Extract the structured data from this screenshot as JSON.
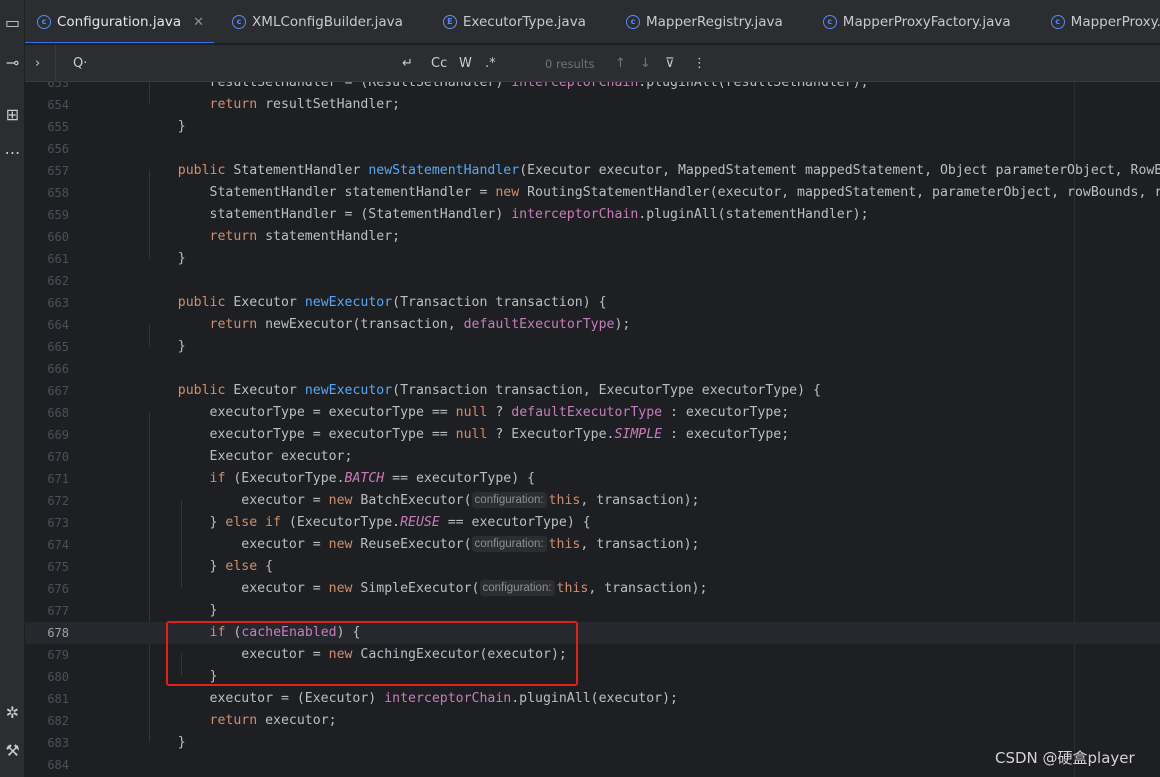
{
  "tabs": [
    {
      "label": "Configuration.java",
      "icon": "class-icon",
      "icon_glyph": "c",
      "active": true,
      "closable": true
    },
    {
      "label": "XMLConfigBuilder.java",
      "icon": "class-icon",
      "icon_glyph": "c"
    },
    {
      "label": "ExecutorType.java",
      "icon": "enum-icon",
      "icon_glyph": "E"
    },
    {
      "label": "MapperRegistry.java",
      "icon": "class-icon",
      "icon_glyph": "c"
    },
    {
      "label": "MapperProxyFactory.java",
      "icon": "class-icon",
      "icon_glyph": "c"
    },
    {
      "label": "MapperProxy.java",
      "icon": "class-icon",
      "icon_glyph": "c"
    }
  ],
  "findbar": {
    "expand_glyph": "›",
    "search_glyph": "Q·",
    "newline_glyph": "↵",
    "match_case": "Cc",
    "whole_words": "W",
    "regex": ".*",
    "results": "0 results",
    "prev_glyph": "↑",
    "next_glyph": "↓",
    "filter_glyph": "⊽",
    "more_glyph": "⋮"
  },
  "toolstrip": {
    "project_glyph": "▭",
    "commit_glyph": "⊸",
    "structure_glyph": "⊞",
    "more_glyph": "⋯",
    "debug_glyph": "✲",
    "build_glyph": "⚒"
  },
  "lines": [
    {
      "num": "653",
      "tokens": [
        [
          "t",
          "        resultSetHandler = (ResultSetHandler) "
        ],
        [
          "fld",
          "interceptorChain"
        ],
        [
          "t",
          ".pluginAll(resultSetHandler);"
        ]
      ]
    },
    {
      "num": "654",
      "tokens": [
        [
          "t",
          "        "
        ],
        [
          "kw",
          "return"
        ],
        [
          "t",
          " resultSetHandler;"
        ]
      ]
    },
    {
      "num": "655",
      "tokens": [
        [
          "t",
          "    }"
        ]
      ]
    },
    {
      "num": "656",
      "tokens": []
    },
    {
      "num": "657",
      "tokens": [
        [
          "t",
          "    "
        ],
        [
          "kw",
          "public"
        ],
        [
          "t",
          " StatementHandler "
        ],
        [
          "fn",
          "newStatementHandler"
        ],
        [
          "t",
          "(Executor executor, MappedStatement mappedStatement, Object parameterObject, RowBounds rowBounds"
        ]
      ]
    },
    {
      "num": "658",
      "tokens": [
        [
          "t",
          "        StatementHandler statementHandler = "
        ],
        [
          "kw",
          "new"
        ],
        [
          "t",
          " RoutingStatementHandler(executor, mappedStatement, parameterObject, rowBounds, resultHandler"
        ]
      ]
    },
    {
      "num": "659",
      "tokens": [
        [
          "t",
          "        statementHandler = (StatementHandler) "
        ],
        [
          "fld",
          "interceptorChain"
        ],
        [
          "t",
          ".pluginAll(statementHandler);"
        ]
      ]
    },
    {
      "num": "660",
      "tokens": [
        [
          "t",
          "        "
        ],
        [
          "kw",
          "return"
        ],
        [
          "t",
          " statementHandler;"
        ]
      ]
    },
    {
      "num": "661",
      "tokens": [
        [
          "t",
          "    }"
        ]
      ]
    },
    {
      "num": "662",
      "tokens": []
    },
    {
      "num": "663",
      "tokens": [
        [
          "t",
          "    "
        ],
        [
          "kw",
          "public"
        ],
        [
          "t",
          " Executor "
        ],
        [
          "fn",
          "newExecutor"
        ],
        [
          "t",
          "(Transaction transaction) {"
        ]
      ]
    },
    {
      "num": "664",
      "tokens": [
        [
          "t",
          "        "
        ],
        [
          "kw",
          "return"
        ],
        [
          "t",
          " newExecutor(transaction, "
        ],
        [
          "fld",
          "defaultExecutorType"
        ],
        [
          "t",
          ");"
        ]
      ]
    },
    {
      "num": "665",
      "tokens": [
        [
          "t",
          "    }"
        ]
      ]
    },
    {
      "num": "666",
      "tokens": []
    },
    {
      "num": "667",
      "tokens": [
        [
          "t",
          "    "
        ],
        [
          "kw",
          "public"
        ],
        [
          "t",
          " Executor "
        ],
        [
          "fn",
          "newExecutor"
        ],
        [
          "t",
          "(Transaction transaction, ExecutorType executorType) {"
        ]
      ]
    },
    {
      "num": "668",
      "tokens": [
        [
          "t",
          "        executorType = executorType == "
        ],
        [
          "kw",
          "null"
        ],
        [
          "t",
          " ? "
        ],
        [
          "fld",
          "defaultExecutorType"
        ],
        [
          "t",
          " : executorType;"
        ]
      ]
    },
    {
      "num": "669",
      "tokens": [
        [
          "t",
          "        executorType = executorType == "
        ],
        [
          "kw",
          "null"
        ],
        [
          "t",
          " ? ExecutorType."
        ],
        [
          "cst",
          "SIMPLE"
        ],
        [
          "t",
          " : executorType;"
        ]
      ]
    },
    {
      "num": "670",
      "tokens": [
        [
          "t",
          "        Executor executor;"
        ]
      ]
    },
    {
      "num": "671",
      "tokens": [
        [
          "t",
          "        "
        ],
        [
          "kw",
          "if"
        ],
        [
          "t",
          " (ExecutorType."
        ],
        [
          "cst",
          "BATCH"
        ],
        [
          "t",
          " == executorType) {"
        ]
      ]
    },
    {
      "num": "672",
      "tokens": [
        [
          "t",
          "            executor = "
        ],
        [
          "kw",
          "new"
        ],
        [
          "t",
          " BatchExecutor("
        ],
        [
          "hint",
          "configuration:"
        ],
        [
          "kw",
          "this"
        ],
        [
          "t",
          ", transaction);"
        ]
      ]
    },
    {
      "num": "673",
      "tokens": [
        [
          "t",
          "        } "
        ],
        [
          "kw",
          "else if"
        ],
        [
          "t",
          " (ExecutorType."
        ],
        [
          "cst",
          "REUSE"
        ],
        [
          "t",
          " == executorType) {"
        ]
      ]
    },
    {
      "num": "674",
      "tokens": [
        [
          "t",
          "            executor = "
        ],
        [
          "kw",
          "new"
        ],
        [
          "t",
          " ReuseExecutor("
        ],
        [
          "hint",
          "configuration:"
        ],
        [
          "kw",
          "this"
        ],
        [
          "t",
          ", transaction);"
        ]
      ]
    },
    {
      "num": "675",
      "tokens": [
        [
          "t",
          "        } "
        ],
        [
          "kw",
          "else"
        ],
        [
          "t",
          " {"
        ]
      ]
    },
    {
      "num": "676",
      "tokens": [
        [
          "t",
          "            executor = "
        ],
        [
          "kw",
          "new"
        ],
        [
          "t",
          " SimpleExecutor("
        ],
        [
          "hint",
          "configuration:"
        ],
        [
          "kw",
          "this"
        ],
        [
          "t",
          ", transaction);"
        ]
      ]
    },
    {
      "num": "677",
      "tokens": [
        [
          "t",
          "        }"
        ]
      ]
    },
    {
      "num": "678",
      "current": true,
      "tokens": [
        [
          "t",
          "        "
        ],
        [
          "kw",
          "if"
        ],
        [
          "t",
          " ("
        ],
        [
          "fld",
          "cacheEnabled"
        ],
        [
          "t",
          ") {"
        ]
      ]
    },
    {
      "num": "679",
      "tokens": [
        [
          "t",
          "            executor = "
        ],
        [
          "kw",
          "new"
        ],
        [
          "t",
          " CachingExecutor(executor);"
        ]
      ]
    },
    {
      "num": "680",
      "tokens": [
        [
          "t",
          "        }"
        ]
      ]
    },
    {
      "num": "681",
      "tokens": [
        [
          "t",
          "        executor = (Executor) "
        ],
        [
          "fld",
          "interceptorChain"
        ],
        [
          "t",
          ".pluginAll(executor);"
        ]
      ]
    },
    {
      "num": "682",
      "tokens": [
        [
          "t",
          "        "
        ],
        [
          "kw",
          "return"
        ],
        [
          "t",
          " executor;"
        ]
      ]
    },
    {
      "num": "683",
      "tokens": [
        [
          "t",
          "    }"
        ]
      ]
    },
    {
      "num": "684",
      "tokens": []
    }
  ],
  "watermark": "CSDN @硬盒player",
  "colors": {
    "keyword": "#cf8e6d",
    "method_decl": "#56a8f5",
    "field": "#c77dbb",
    "text": "#bcbec4",
    "highlight_box": "#e0221b",
    "accent": "#3574f0"
  }
}
